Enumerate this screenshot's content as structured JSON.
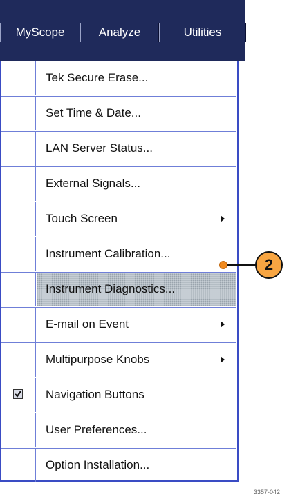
{
  "menubar": {
    "items": [
      {
        "label": "MyScope"
      },
      {
        "label": "Analyze"
      },
      {
        "label": "Utilities"
      }
    ]
  },
  "menu": {
    "items": [
      {
        "label": "Tek Secure Erase...",
        "checked": false,
        "submenu": false
      },
      {
        "label": "Set Time & Date...",
        "checked": false,
        "submenu": false
      },
      {
        "label": "LAN Server Status...",
        "checked": false,
        "submenu": false
      },
      {
        "label": "External Signals...",
        "checked": false,
        "submenu": false
      },
      {
        "label": "Touch Screen",
        "checked": false,
        "submenu": true
      },
      {
        "label": "Instrument Calibration...",
        "checked": false,
        "submenu": false
      },
      {
        "label": "Instrument Diagnostics...",
        "checked": false,
        "submenu": false,
        "highlighted": true
      },
      {
        "label": "E-mail on Event",
        "checked": false,
        "submenu": true
      },
      {
        "label": "Multipurpose Knobs",
        "checked": false,
        "submenu": true
      },
      {
        "label": "Navigation Buttons",
        "checked": true,
        "submenu": false
      },
      {
        "label": "User Preferences...",
        "checked": false,
        "submenu": false
      },
      {
        "label": "Option Installation...",
        "checked": false,
        "submenu": false
      }
    ]
  },
  "callout": {
    "number": "2",
    "color": "#f7a542"
  },
  "figure_id": "3357-042",
  "colors": {
    "menubar_bg": "#1f2a5b",
    "menu_border": "#3a4cc4"
  }
}
